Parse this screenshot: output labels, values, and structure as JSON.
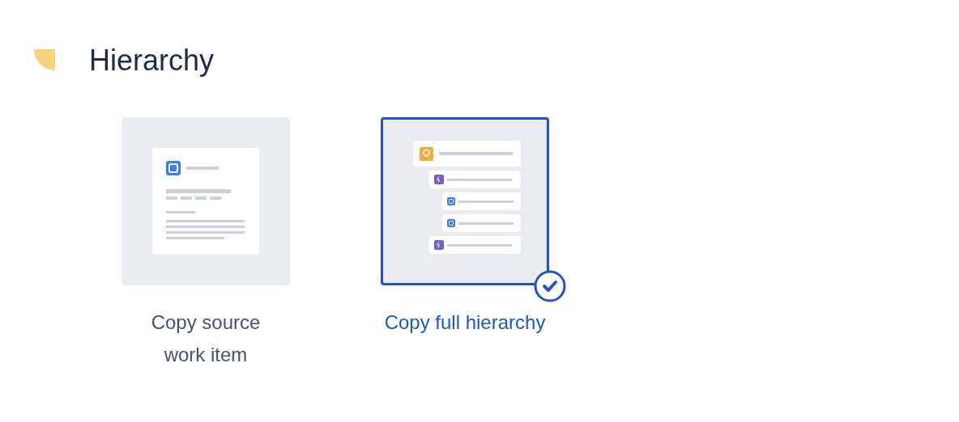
{
  "section": {
    "title": "Hierarchy"
  },
  "options": [
    {
      "label": "Copy source work item",
      "selected": false,
      "kind": "single"
    },
    {
      "label": "Copy full hierarchy",
      "selected": true,
      "kind": "hierarchy"
    }
  ]
}
